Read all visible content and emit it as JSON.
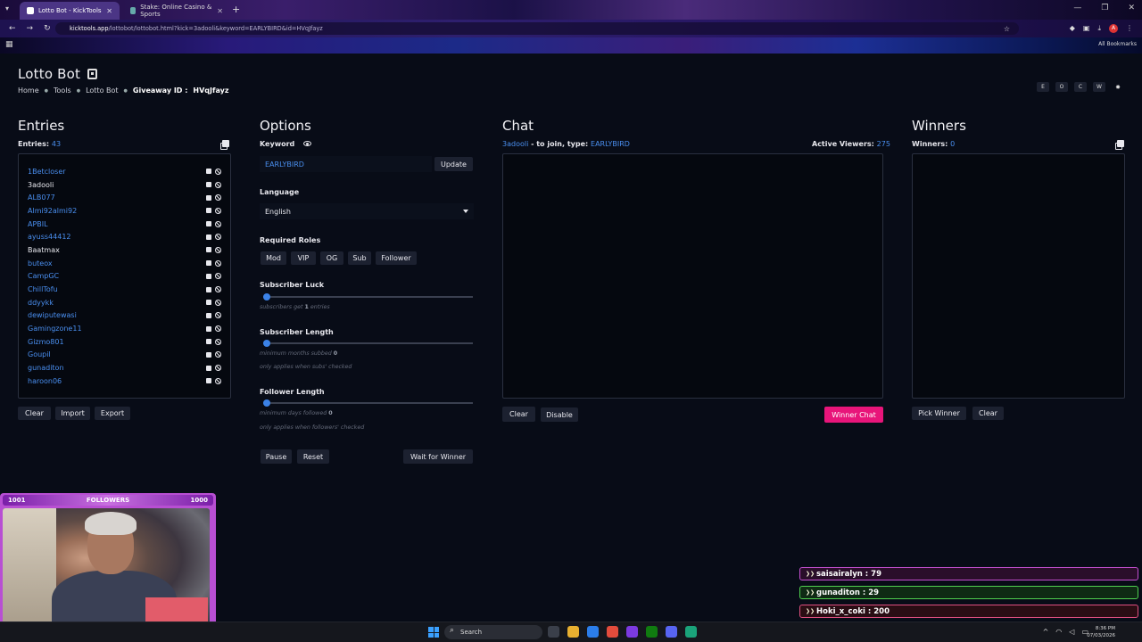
{
  "browser": {
    "tabs": [
      {
        "label": "Lotto Bot - KickTools",
        "active": true
      },
      {
        "label": "Stake: Online Casino & Sports",
        "active": false
      }
    ],
    "url_site": "kicktools.app",
    "url_path": "/lottobot/lottobot.html?kick=3adooli&keyword=EARLYBIRD&id=HVqJfayz",
    "all_bookmarks": "All Bookmarks"
  },
  "page": {
    "title": "Lotto Bot",
    "breadcrumb": [
      "Home",
      "Tools",
      "Lotto Bot"
    ],
    "giveaway_label": "Giveaway ID :",
    "giveaway_id": "HVqJfayz",
    "top_buttons": [
      "E",
      "O",
      "C",
      "W"
    ]
  },
  "entries": {
    "heading": "Entries",
    "count_label": "Entries:",
    "count": "43",
    "items": [
      {
        "name": "1Betcloser",
        "color": "blue"
      },
      {
        "name": "3adooli",
        "color": "white"
      },
      {
        "name": "ALB077",
        "color": "blue"
      },
      {
        "name": "Almi92almi92",
        "color": "blue"
      },
      {
        "name": "APBIL",
        "color": "blue"
      },
      {
        "name": "ayuss44412",
        "color": "blue"
      },
      {
        "name": "Baatmax",
        "color": "white"
      },
      {
        "name": "buteox",
        "color": "blue"
      },
      {
        "name": "CampGC",
        "color": "blue"
      },
      {
        "name": "ChillTofu",
        "color": "blue"
      },
      {
        "name": "ddyykk",
        "color": "blue"
      },
      {
        "name": "dewiputewasi",
        "color": "blue"
      },
      {
        "name": "Gamingzone11",
        "color": "blue"
      },
      {
        "name": "Gizmo801",
        "color": "blue"
      },
      {
        "name": "Goupil",
        "color": "blue"
      },
      {
        "name": "gunaditon",
        "color": "blue"
      },
      {
        "name": "haroon06",
        "color": "blue"
      }
    ],
    "buttons": {
      "clear": "Clear",
      "import": "Import",
      "export": "Export"
    }
  },
  "options": {
    "heading": "Options",
    "keyword_label": "Keyword",
    "keyword_value": "EARLYBIRD",
    "update_button": "Update",
    "language_label": "Language",
    "language_value": "English",
    "roles_label": "Required Roles",
    "roles": [
      "Mod",
      "VIP",
      "OG",
      "Sub",
      "Follower"
    ],
    "sub_luck": {
      "label": "Subscriber Luck",
      "hint_pre": "subscribers get",
      "value": "1",
      "hint_post": "entries",
      "level": 0
    },
    "sub_length": {
      "label": "Subscriber Length",
      "hint_pre": "minimum months subbed",
      "value": "0",
      "note": "only applies when subs' checked",
      "level": 0
    },
    "follower_length": {
      "label": "Follower Length",
      "hint_pre": "minimum days followed",
      "value": "0",
      "note": "only applies when followers' checked",
      "level": 0
    },
    "buttons": {
      "pause": "Pause",
      "reset": "Reset",
      "wait": "Wait for Winner"
    }
  },
  "chat": {
    "heading": "Chat",
    "user": "3adooli",
    "join_text": "- to join, type:",
    "keyword": "EARLYBIRD",
    "viewers_label": "Active Viewers:",
    "viewers": "275",
    "buttons": {
      "clear": "Clear",
      "disable": "Disable",
      "winner_chat": "Winner Chat"
    }
  },
  "winners": {
    "heading": "Winners",
    "count_label": "Winners:",
    "count": "0",
    "buttons": {
      "pick": "Pick Winner",
      "clear": "Clear"
    }
  },
  "overlay": {
    "followers_left": "1001",
    "followers_label": "FOLLOWERS",
    "followers_right": "1000",
    "alerts": [
      {
        "text": "saisairalyn : 79"
      },
      {
        "text": "gunaditon : 29"
      },
      {
        "text": "Hoki_x_coki : 200"
      }
    ]
  },
  "taskbar": {
    "search": "Search",
    "time": "8:36 PM",
    "date": "07/03/2026"
  }
}
